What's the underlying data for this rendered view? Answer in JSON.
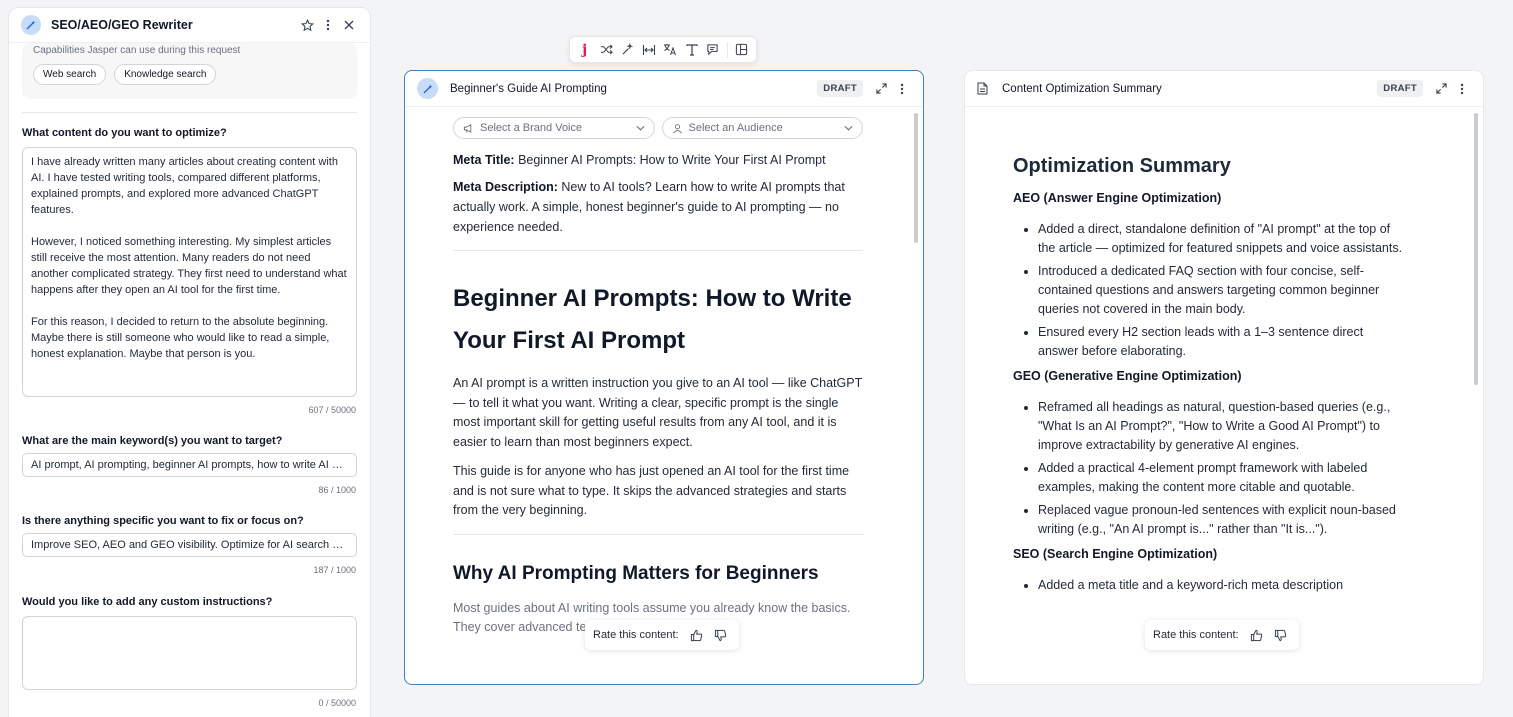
{
  "tool": {
    "title": "SEO/AEO/GEO Rewriter",
    "capabilities_label": "Capabilities Jasper can use during this request",
    "chips": [
      "Web search",
      "Knowledge search"
    ],
    "q1": "What content do you want to optimize?",
    "content_value": "I have already written many articles about creating content with AI. I have tested writing tools, compared different platforms, explained prompts, and explored more advanced ChatGPT features.\n\nHowever, I noticed something interesting. My simplest articles still receive the most attention. Many readers do not need another complicated strategy. They first need to understand what happens after they open an AI tool for the first time.\n\nFor this reason, I decided to return to the absolute beginning. Maybe there is still someone who would like to read a simple, honest explanation. Maybe that person is you.",
    "content_count": "607 / 50000",
    "q2": "What are the main keyword(s) you want to target?",
    "keywords_value": "AI prompt, AI prompting, beginner AI prompts, how to write AI prompts",
    "keywords_count": "86 / 1000",
    "q3": "Is there anything specific you want to fix or focus on?",
    "focus_value": "Improve SEO, AEO and GEO visibility. Optimize for AI search engines",
    "focus_count": "187 / 1000",
    "q4": "Would you like to add any custom instructions?",
    "custom_value": "",
    "custom_count": "0 / 50000"
  },
  "doc": {
    "title": "Beginner's Guide AI Prompting",
    "badge": "DRAFT",
    "brand_voice_placeholder": "Select a Brand Voice",
    "audience_placeholder": "Select an Audience",
    "meta_title_label": "Meta Title:",
    "meta_title": " Beginner AI Prompts: How to Write Your First AI Prompt",
    "meta_desc_label": "Meta Description:",
    "meta_desc": " New to AI tools? Learn how to write AI prompts that actually work. A simple, honest beginner's guide to AI prompting — no experience needed.",
    "h1": "Beginner AI Prompts: How to Write Your First AI Prompt",
    "p1": "An AI prompt is a written instruction you give to an AI tool — like ChatGPT — to tell it what you want. Writing a clear, specific prompt is the single most important skill for getting useful results from any AI tool, and it is easier to learn than most beginners expect.",
    "p2": "This guide is for anyone who has just opened an AI tool for the first time and is not sure what to type. It skips the advanced strategies and starts from the very beginning.",
    "h2": "Why AI Prompting Matters for Beginners",
    "p3": "Most guides about AI writing tools assume you already know the basics. They cover advanced techniques like prompt"
  },
  "summary": {
    "title": "Content Optimization Summary",
    "badge": "DRAFT",
    "heading": "Optimization Summary",
    "aeo_title": "AEO (Answer Engine Optimization)",
    "aeo_items": [
      "Added a direct, standalone definition of \"AI prompt\" at the top of the article — optimized for featured snippets and voice assistants.",
      "Introduced a dedicated FAQ section with four concise, self-contained questions and answers targeting common beginner queries not covered in the main body.",
      "Ensured every H2 section leads with a 1–3 sentence direct answer before elaborating."
    ],
    "geo_title": "GEO (Generative Engine Optimization)",
    "geo_items": [
      "Reframed all headings as natural, question-based queries (e.g., \"What Is an AI Prompt?\", \"How to Write a Good AI Prompt\") to improve extractability by generative AI engines.",
      "Added a practical 4-element prompt framework with labeled examples, making the content more citable and quotable.",
      "Replaced vague pronoun-led sentences with explicit noun-based writing (e.g., \"An AI prompt is...\" rather than \"It is...\")."
    ],
    "seo_title": "SEO (Search Engine Optimization)",
    "seo_items": [
      "Added a meta title and a keyword-rich meta description"
    ]
  },
  "rate_label": "Rate this content:",
  "colors": {
    "accent": "#3b82c4",
    "brand_red": "#e11d48"
  }
}
